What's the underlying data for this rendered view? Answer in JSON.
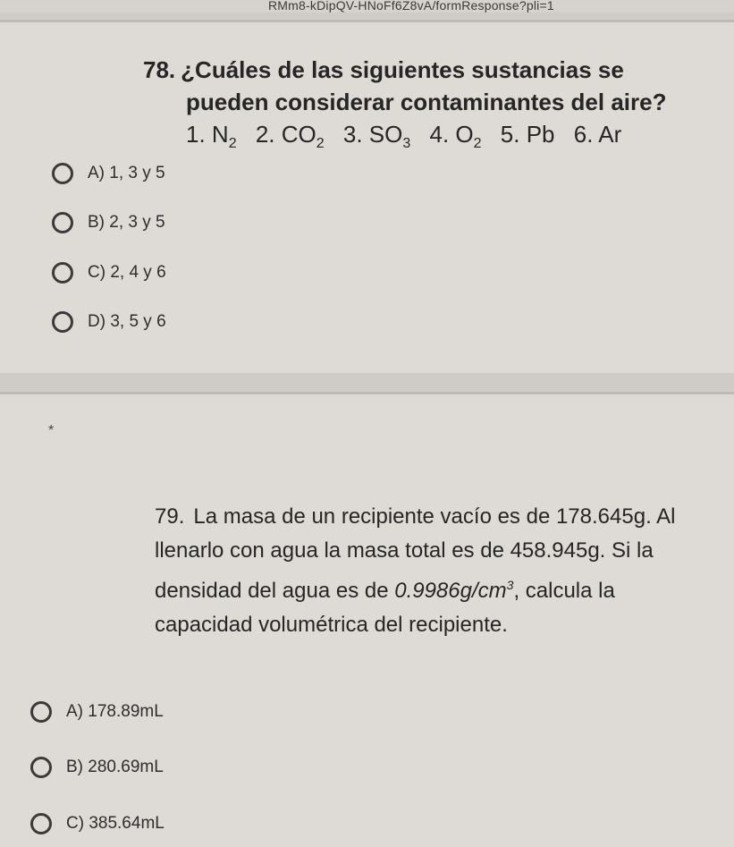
{
  "browser": {
    "url_fragment": "RMm8-kDipQV-HNoFf6Z8vA/formResponse?pli=1"
  },
  "question78": {
    "number": "78.",
    "text_line1": "¿Cuáles de las siguientes sustancias se",
    "text_line2": "pueden considerar contaminantes del aire?",
    "formulas": [
      {
        "prefix": "1. N",
        "sub": "2"
      },
      {
        "prefix": "2. CO",
        "sub": "2"
      },
      {
        "prefix": "3. SO",
        "sub": "3"
      },
      {
        "prefix": "4. O",
        "sub": "2"
      },
      {
        "prefix": "5. Pb",
        "sub": ""
      },
      {
        "prefix": "6. Ar",
        "sub": ""
      }
    ],
    "options": [
      {
        "label": "A) 1, 3 y 5"
      },
      {
        "label": "B) 2, 3 y 5"
      },
      {
        "label": "C) 2, 4 y 6"
      },
      {
        "label": "D) 3, 5 y 6"
      }
    ]
  },
  "question79": {
    "required_marker": "*",
    "number": "79.",
    "text_part1": "La masa de un recipiente vacío es de 178.645g. Al llenarlo con agua la masa total es de 458.945g. Si la densidad del agua es de ",
    "density_value": "0.9986g/cm",
    "density_exp": "3",
    "text_part2": ", calcula la capacidad volumétrica del recipiente.",
    "options": [
      {
        "label": "A) 178.89mL"
      },
      {
        "label": "B) 280.69mL"
      },
      {
        "label": "C) 385.64mL"
      }
    ]
  }
}
